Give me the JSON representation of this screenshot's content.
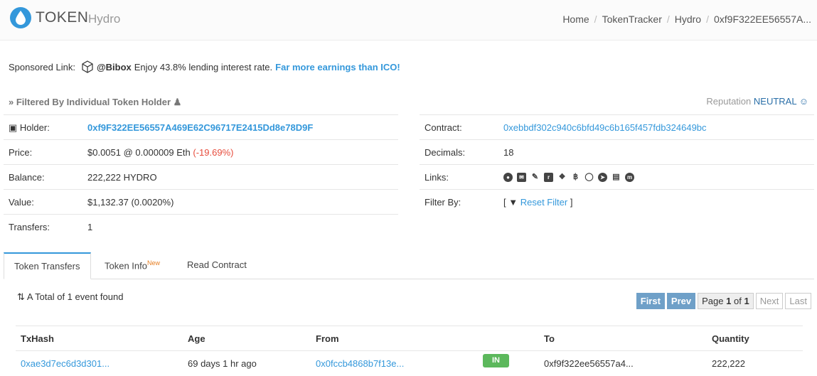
{
  "header": {
    "title": "TOKEN",
    "subtitle": "Hydro",
    "breadcrumb": [
      "Home",
      "TokenTracker",
      "Hydro",
      "0xf9F322EE56557A..."
    ]
  },
  "sponsored": {
    "label": "Sponsored Link:",
    "brand": "@Bibox",
    "text": "Enjoy 43.8% lending interest rate.",
    "cta": "Far more earnings than ICO!"
  },
  "filter": {
    "title": "Filtered By Individual Token Holder",
    "reputation_label": "Reputation",
    "reputation_value": "NEUTRAL"
  },
  "holder_table": {
    "holder_label": "Holder:",
    "holder_value": "0xf9F322EE56557A469E62C96717E2415Dd8e78D9F",
    "price_label": "Price:",
    "price_value": "$0.0051 @ 0.000009 Eth",
    "price_change": "(-19.69%)",
    "balance_label": "Balance:",
    "balance_value": "222,222 HYDRO",
    "value_label": "Value:",
    "value_value": "$1,132.37 (0.0020%)",
    "transfers_label": "Transfers:",
    "transfers_value": "1"
  },
  "contract_table": {
    "contract_label": "Contract:",
    "contract_value": "0xebbdf302c940c6bfd49c6b165f457fdb324649bc",
    "decimals_label": "Decimals:",
    "decimals_value": "18",
    "links_label": "Links:",
    "link_icons": [
      "globe-icon",
      "envelope-icon",
      "edit-icon",
      "reddit-icon",
      "twitter-icon",
      "bitcoin-icon",
      "github-icon",
      "telegram-icon",
      "document-icon",
      "coinmarketcap-icon"
    ],
    "filterby_label": "Filter By:",
    "reset_filter": "Reset Filter"
  },
  "tabs": [
    {
      "label": "Token Transfers",
      "active": true
    },
    {
      "label": "Token Info",
      "badge": "New"
    },
    {
      "label": "Read Contract"
    }
  ],
  "events": {
    "total_text": "A Total of 1 event found"
  },
  "pager": {
    "first": "First",
    "prev": "Prev",
    "page_prefix": "Page",
    "page_num": "1",
    "page_of": "of",
    "page_total": "1",
    "next": "Next",
    "last": "Last"
  },
  "transfers": {
    "columns": [
      "TxHash",
      "Age",
      "From",
      "To",
      "Quantity"
    ],
    "rows": [
      {
        "txhash": "0xae3d7ec6d3d301...",
        "age": "69 days 1 hr ago",
        "from": "0x0fccb4868b7f13e...",
        "direction": "IN",
        "to": "0xf9f322ee56557a4...",
        "quantity": "222,222"
      }
    ]
  },
  "colors": {
    "accent": "#3498db",
    "negative": "#e74c3c",
    "in_badge": "#5cb85c",
    "pager_active": "#6fa0c8"
  }
}
